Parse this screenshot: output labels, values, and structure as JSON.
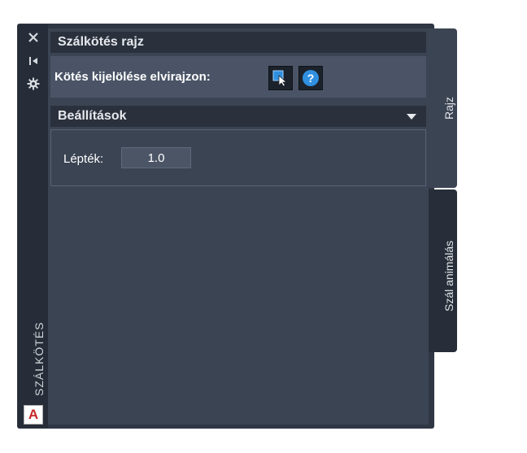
{
  "palette": {
    "vertical_title": "SZÁLKÖTÉS",
    "strip_icons": [
      "close-icon",
      "pin-icon",
      "gear-icon"
    ],
    "app_logo_letter": "A",
    "app_logo_color": "#c62828"
  },
  "section1": {
    "title": "Szálkötés rajz",
    "select_label": "Kötés kijelölése elvirajzon:",
    "buttons": [
      "select-icon",
      "help-icon"
    ]
  },
  "section2": {
    "title": "Beállítások",
    "scale_label": "Lépték:",
    "scale_value": "1.0"
  },
  "tabs": [
    {
      "label": "Rajz",
      "active": true
    },
    {
      "label": "Szál animálás",
      "active": false
    }
  ],
  "colors": {
    "panel": "#2f3745",
    "content": "#3b4453",
    "accent_help": "#2f8fe0"
  }
}
